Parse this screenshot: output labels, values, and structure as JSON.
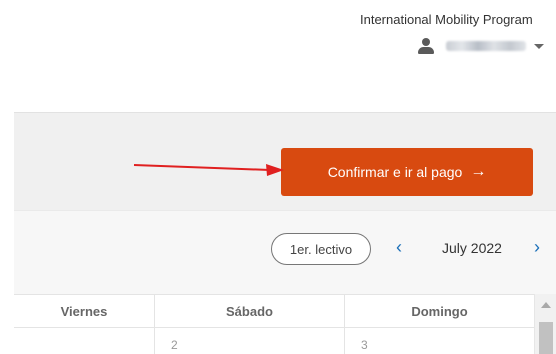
{
  "header": {
    "program_name": "International Mobility Program",
    "user": {
      "name": ""
    }
  },
  "confirm": {
    "button_label": "Confirmar e ir al pago",
    "arrow": "→",
    "button_color": "#d84a10"
  },
  "nav": {
    "term_label": "1er. lectivo",
    "prev_symbol": "‹",
    "month_label": "July 2022",
    "next_symbol": "›",
    "accent_color": "#1a6fb8"
  },
  "calendar": {
    "headers": [
      "Viernes",
      "Sábado",
      "Domingo"
    ],
    "row1": [
      "",
      "2",
      "3"
    ]
  },
  "annotation": {
    "arrow_color": "#e02020"
  }
}
